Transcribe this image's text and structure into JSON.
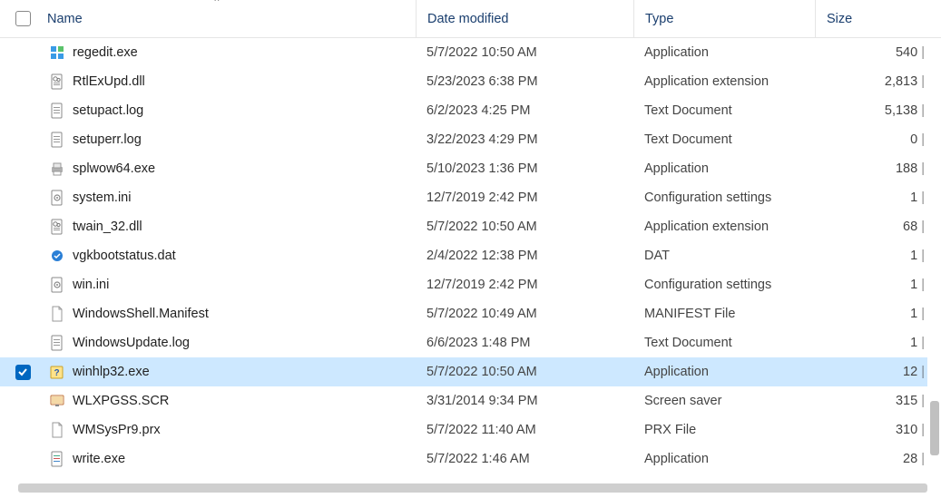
{
  "columns": {
    "name": "Name",
    "date": "Date modified",
    "type": "Type",
    "size": "Size"
  },
  "sort": {
    "column": "name",
    "direction": "asc"
  },
  "files": [
    {
      "icon": "regedit",
      "name": "regedit.exe",
      "date": "5/7/2022 10:50 AM",
      "type": "Application",
      "size": "540",
      "selected": false
    },
    {
      "icon": "dll",
      "name": "RtlExUpd.dll",
      "date": "5/23/2023 6:38 PM",
      "type": "Application extension",
      "size": "2,813",
      "size_cut": true,
      "selected": false
    },
    {
      "icon": "txt",
      "name": "setupact.log",
      "date": "6/2/2023 4:25 PM",
      "type": "Text Document",
      "size": "5,138",
      "size_cut": true,
      "selected": false
    },
    {
      "icon": "txt",
      "name": "setuperr.log",
      "date": "3/22/2023 4:29 PM",
      "type": "Text Document",
      "size": "0",
      "selected": false
    },
    {
      "icon": "printer",
      "name": "splwow64.exe",
      "date": "5/10/2023 1:36 PM",
      "type": "Application",
      "size": "188",
      "selected": false
    },
    {
      "icon": "ini",
      "name": "system.ini",
      "date": "12/7/2019 2:42 PM",
      "type": "Configuration settings",
      "size": "1",
      "selected": false
    },
    {
      "icon": "dll",
      "name": "twain_32.dll",
      "date": "5/7/2022 10:50 AM",
      "type": "Application extension",
      "size": "68",
      "selected": false
    },
    {
      "icon": "dat",
      "name": "vgkbootstatus.dat",
      "date": "2/4/2022 12:38 PM",
      "type": "DAT",
      "size": "1",
      "selected": false
    },
    {
      "icon": "ini",
      "name": "win.ini",
      "date": "12/7/2019 2:42 PM",
      "type": "Configuration settings",
      "size": "1",
      "selected": false
    },
    {
      "icon": "file",
      "name": "WindowsShell.Manifest",
      "date": "5/7/2022 10:49 AM",
      "type": "MANIFEST File",
      "size": "1",
      "selected": false
    },
    {
      "icon": "txt",
      "name": "WindowsUpdate.log",
      "date": "6/6/2023 1:48 PM",
      "type": "Text Document",
      "size": "1",
      "selected": false
    },
    {
      "icon": "help",
      "name": "winhlp32.exe",
      "date": "5/7/2022 10:50 AM",
      "type": "Application",
      "size": "12",
      "selected": true
    },
    {
      "icon": "scr",
      "name": "WLXPGSS.SCR",
      "date": "3/31/2014 9:34 PM",
      "type": "Screen saver",
      "size": "315",
      "selected": false
    },
    {
      "icon": "file",
      "name": "WMSysPr9.prx",
      "date": "5/7/2022 11:40 AM",
      "type": "PRX File",
      "size": "310",
      "selected": false
    },
    {
      "icon": "write",
      "name": "write.exe",
      "date": "5/7/2022 1:46 AM",
      "type": "Application",
      "size": "28",
      "selected": false
    }
  ]
}
